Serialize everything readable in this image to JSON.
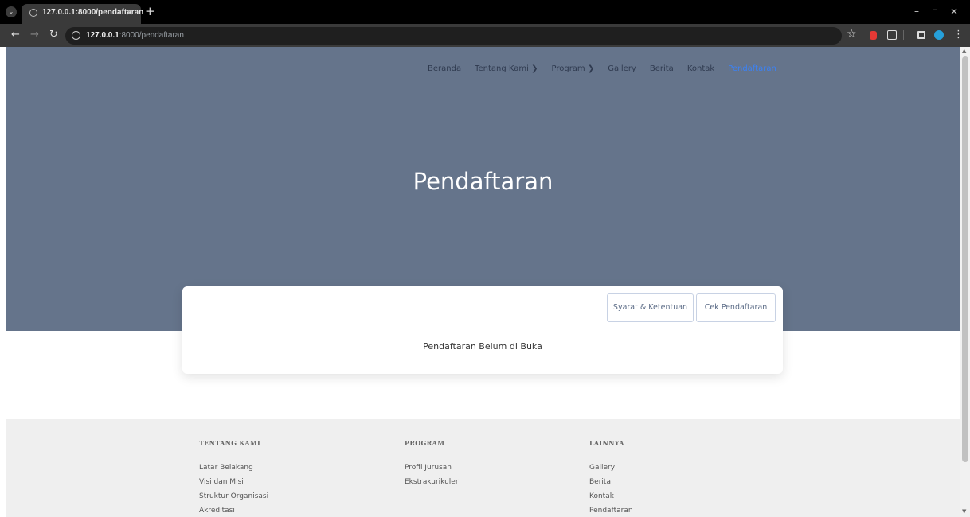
{
  "browser": {
    "tab_title": "127.0.0.1:8000/pendaftaran",
    "tab_close": "×",
    "new_tab": "+",
    "url_host": "127.0.0.1",
    "url_rest": ":8000/pendaftaran",
    "window_controls": [
      "–",
      "▫",
      "×"
    ]
  },
  "nav": {
    "items": [
      {
        "label": "Beranda"
      },
      {
        "label": "Tentang Kami ❯"
      },
      {
        "label": "Program ❯"
      },
      {
        "label": "Gallery"
      },
      {
        "label": "Berita"
      },
      {
        "label": "Kontak"
      },
      {
        "label": "Pendaftaran",
        "active": true
      }
    ]
  },
  "hero": {
    "title": "Pendaftaran"
  },
  "card": {
    "syarat_label": "Syarat & Ketentuan",
    "cek_label": "Cek Pendaftaran",
    "message": "Pendaftaran Belum di Buka"
  },
  "footer": {
    "columns": [
      {
        "heading": "TENTANG KAMI",
        "links": [
          "Latar Belakang",
          "Visi dan Misi",
          "Struktur Organisasi",
          "Akreditasi"
        ]
      },
      {
        "heading": "PROGRAM",
        "links": [
          "Profil Jurusan",
          "Ekstrakurikuler"
        ]
      },
      {
        "heading": "LAINNYA",
        "links": [
          "Gallery",
          "Berita",
          "Kontak",
          "Pendaftaran"
        ]
      }
    ]
  },
  "colors": {
    "hero_bg": "#65748b",
    "nav_active": "#3b82f6",
    "footer_bg": "#efefef"
  }
}
